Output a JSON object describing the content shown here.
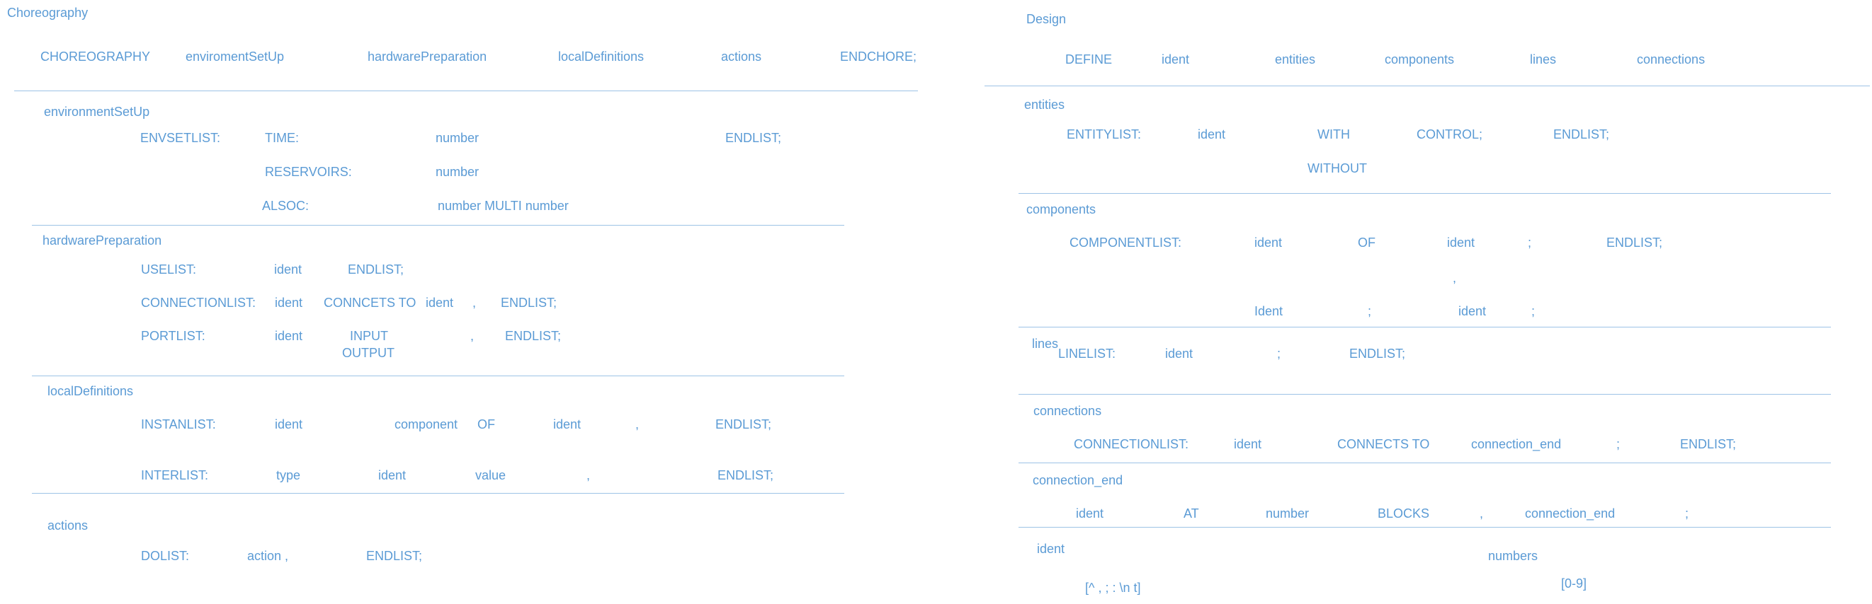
{
  "choreography": {
    "title": "Choreography",
    "header": [
      "CHOREOGRAPHY",
      "enviromentSetUp",
      "hardwarePreparation",
      "localDefinitions",
      "actions",
      "ENDCHORE;"
    ],
    "environmentSetUp": {
      "title": "environmentSetUp",
      "envsetlist": "ENVSETLIST:",
      "time": "TIME:",
      "time_value": "number",
      "reservoirs": "RESERVOIRS:",
      "reservoirs_value": "number",
      "alsoc": "ALSOC:",
      "alsoc_value": "number  MULTI number",
      "endlist": "ENDLIST;"
    },
    "hardwarePreparation": {
      "title": "hardwarePreparation",
      "uselist": [
        "USELIST:",
        "ident",
        "ENDLIST;"
      ],
      "connectionlist": [
        "CONNECTIONLIST:",
        "ident",
        "CONNCETS TO",
        "ident",
        ",",
        "ENDLIST;"
      ],
      "portlist": [
        "PORTLIST:",
        "ident",
        "INPUT",
        "OUTPUT",
        ",",
        "ENDLIST;"
      ]
    },
    "localDefinitions": {
      "title": "localDefinitions",
      "instanlist": [
        "INSTANLIST:",
        "ident",
        "component",
        "OF",
        "ident",
        ",",
        "ENDLIST;"
      ],
      "interlist": [
        "INTERLIST:",
        "type",
        "ident",
        "value",
        ",",
        "ENDLIST;"
      ]
    },
    "actions": {
      "title": "actions",
      "dolist": [
        "DOLIST:",
        "action ,",
        "ENDLIST;"
      ]
    }
  },
  "design": {
    "title": "Design",
    "header": [
      "DEFINE",
      "ident",
      "entities",
      "components",
      "lines",
      "connections"
    ],
    "entities": {
      "title": "entities",
      "row": [
        "ENTITYLIST:",
        "ident",
        "WITH",
        "CONTROL;",
        "ENDLIST;"
      ],
      "alt": "WITHOUT"
    },
    "components": {
      "title": "components",
      "row1": [
        "COMPONENTLIST:",
        "ident",
        "OF",
        "ident",
        ";",
        "ENDLIST;"
      ],
      "comma": ",",
      "row2": [
        "Ident",
        ";",
        "ident",
        ";"
      ]
    },
    "lines": {
      "title": "lines",
      "row": [
        "LINELIST:",
        "ident",
        ";",
        "ENDLIST;"
      ]
    },
    "connections": {
      "title": "connections",
      "row": [
        "CONNECTIONLIST:",
        "ident",
        "CONNECTS TO",
        "connection_end",
        ";",
        "ENDLIST;"
      ]
    },
    "connection_end": {
      "title": "connection_end",
      "row": [
        "ident",
        "AT",
        "number",
        "BLOCKS",
        ",",
        "connection_end",
        ";"
      ]
    },
    "ident": {
      "title": "ident",
      "pattern": "[^ , ; : \\n t]"
    },
    "numbers": {
      "title": "numbers",
      "pattern": "[0-9]"
    }
  }
}
